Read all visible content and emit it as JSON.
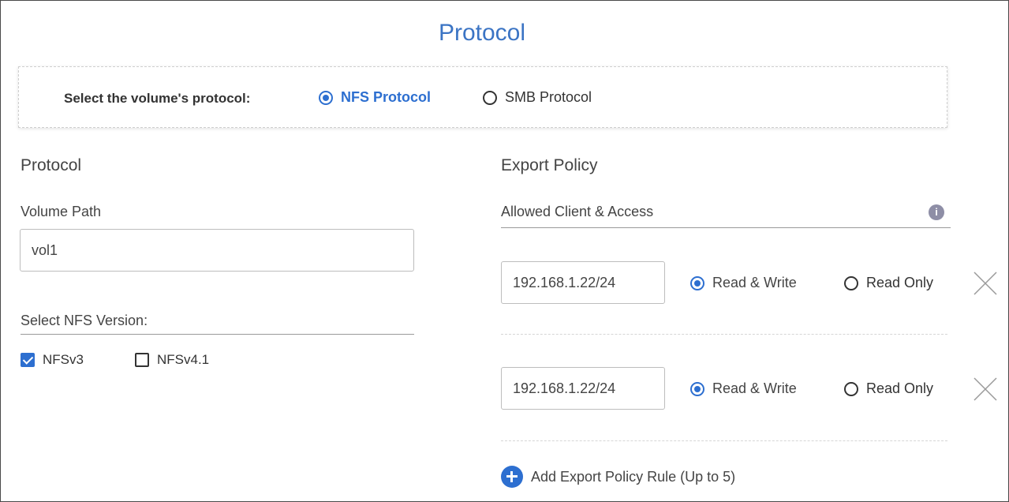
{
  "title": "Protocol",
  "protocol_select": {
    "label": "Select the volume's protocol:",
    "options": [
      {
        "label": "NFS Protocol",
        "selected": true
      },
      {
        "label": "SMB Protocol",
        "selected": false
      }
    ]
  },
  "left": {
    "heading": "Protocol",
    "volume_path_label": "Volume Path",
    "volume_path_value": "vol1",
    "nfs_version_label": "Select NFS Version:",
    "versions": [
      {
        "label": "NFSv3",
        "checked": true
      },
      {
        "label": "NFSv4.1",
        "checked": false
      }
    ]
  },
  "right": {
    "heading": "Export Policy",
    "allowed_label": "Allowed Client & Access",
    "info_icon": "info-icon",
    "rules": [
      {
        "client": "192.168.1.22/24",
        "read_write": "Read & Write",
        "read_only": "Read Only",
        "access": "read_write"
      },
      {
        "client": "192.168.1.22/24",
        "read_write": "Read & Write",
        "read_only": "Read Only",
        "access": "read_write"
      }
    ],
    "add_rule_label": "Add Export Policy Rule (Up to 5)"
  },
  "colors": {
    "accent": "#2d6fd0",
    "title": "#3b74c4"
  }
}
